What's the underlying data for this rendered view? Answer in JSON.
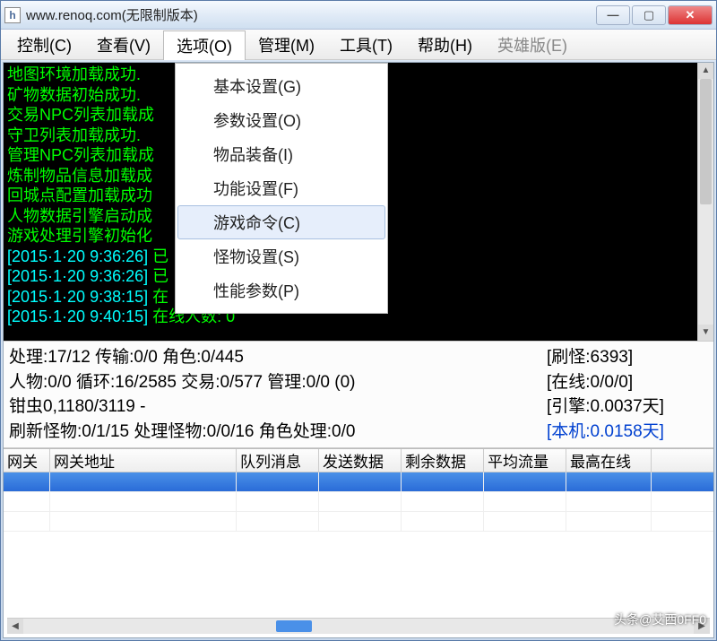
{
  "titlebar": {
    "icon_letter": "h",
    "title": "www.renoq.com(无限制版本)"
  },
  "menubar": {
    "items": [
      {
        "label": "控制(C)"
      },
      {
        "label": "查看(V)"
      },
      {
        "label": "选项(O)",
        "open": true
      },
      {
        "label": "管理(M)"
      },
      {
        "label": "工具(T)"
      },
      {
        "label": "帮助(H)"
      },
      {
        "label": "英雄版(E)",
        "disabled": true
      }
    ]
  },
  "dropdown": {
    "items": [
      {
        "label": "基本设置(G)"
      },
      {
        "label": "参数设置(O)"
      },
      {
        "label": "物品装备(I)"
      },
      {
        "label": "功能设置(F)"
      },
      {
        "label": "游戏命令(C)",
        "selected": true
      },
      {
        "label": "怪物设置(S)"
      },
      {
        "label": "性能参数(P)"
      }
    ]
  },
  "console": {
    "lines": [
      {
        "text": "地图环境加载成功."
      },
      {
        "text": "矿物数据初始成功."
      },
      {
        "text": "交易NPC列表加载成"
      },
      {
        "text": "守卫列表加载成功."
      },
      {
        "text": "管理NPC列表加载成"
      },
      {
        "text": "炼制物品信息加载成"
      },
      {
        "text": "回城点配置加载成功"
      },
      {
        "text": "人物数据引擎启动成"
      },
      {
        "text": "游戏处理引擎初始化"
      },
      {
        "ts": "[2015·1·20 9:36:26]",
        "text": " 已"
      },
      {
        "ts": "[2015·1·20 9:36:26]",
        "text": " 已"
      },
      {
        "ts": "[2015·1·20 9:38:15]",
        "text": " 在"
      },
      {
        "ts": "[2015·1·20 9:40:15]",
        "text": " 在线人数: 0"
      }
    ]
  },
  "stats": {
    "rows": [
      {
        "left": "处理:17/12  传输:0/0  角色:0/445",
        "right": "[刷怪:6393]"
      },
      {
        "left": "人物:0/0  循环:16/2585  交易:0/577  管理:0/0  (0)",
        "right": "[在线:0/0/0]"
      },
      {
        "left": "钳虫0,1180/3119  -",
        "right": "[引擎:0.0037天]"
      },
      {
        "left": "刷新怪物:0/1/15  处理怪物:0/0/16  角色处理:0/0",
        "right": "[本机:0.0158天]",
        "right_blue": true
      }
    ]
  },
  "table": {
    "columns": [
      "网关",
      "网关地址",
      "队列消息",
      "发送数据",
      "剩余数据",
      "平均流量",
      "最高在线"
    ]
  },
  "watermark": "头条@艾西0FF0"
}
